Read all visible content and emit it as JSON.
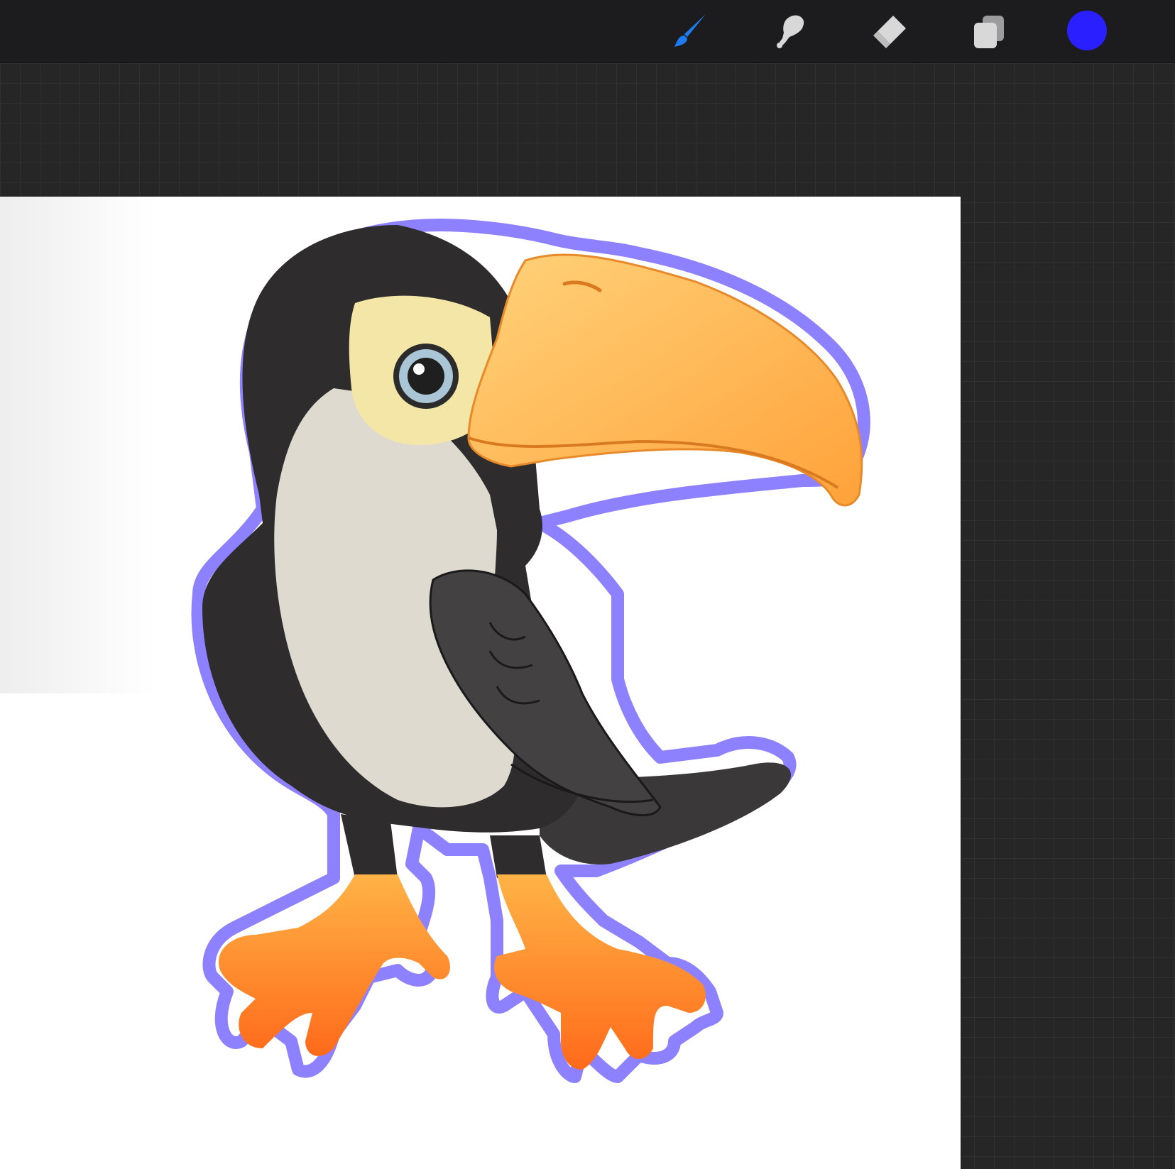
{
  "toolbar": {
    "tools": [
      {
        "name": "brush",
        "icon": "brush-icon",
        "active": true,
        "color": "#1e7cf2"
      },
      {
        "name": "smudge",
        "icon": "smudge-icon",
        "active": false,
        "color": "#d8d8d8"
      },
      {
        "name": "eraser",
        "icon": "eraser-icon",
        "active": false,
        "color": "#d8d8d8"
      },
      {
        "name": "layers",
        "icon": "layers-icon",
        "active": false,
        "color": "#d8d8d8"
      }
    ],
    "current_color": "#2a1fff"
  },
  "canvas": {
    "background": "#ffffff",
    "artwork": "toucan-illustration",
    "outline_color": "#6b5cff"
  }
}
